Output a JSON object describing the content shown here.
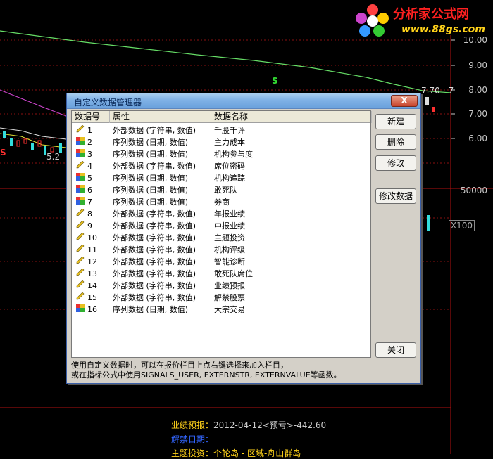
{
  "background": {
    "price_axis": [
      "10.00",
      "9.00",
      "8.00",
      "7.00",
      "6.00"
    ],
    "volume_label": "50000",
    "x_label": "X100",
    "markers": [
      "S",
      "S",
      "S"
    ],
    "low_label": "5.2",
    "high_label": "7.70 - 7"
  },
  "logo": {
    "text": "分析家公式网",
    "url": "www.88gs.com"
  },
  "footer": {
    "line1_label": "业绩预报：",
    "line1_value": "2012-04-12<预亏>-442.60",
    "line2": "解禁日期：",
    "line3": "主题投资：个轮岛 - 区域-舟山群岛"
  },
  "dialog": {
    "title": "自定义数据管理器",
    "close_label": "X",
    "columns": [
      "数据号",
      "属性",
      "数据名称"
    ],
    "rows": [
      {
        "num": "1",
        "attr": "外部数据 (字符串, 数值)",
        "name": "千股千评",
        "icon": "pencil-icon"
      },
      {
        "num": "2",
        "attr": "序列数据 (日期, 数值)",
        "name": "主力成本",
        "icon": "multicolor-data-icon"
      },
      {
        "num": "3",
        "attr": "序列数据 (日期, 数值)",
        "name": "机构参与度",
        "icon": "multicolor-data-icon"
      },
      {
        "num": "4",
        "attr": "外部数据 (字符串, 数值)",
        "name": "席位密码",
        "icon": "pencil-icon"
      },
      {
        "num": "5",
        "attr": "序列数据 (日期, 数值)",
        "name": "机构追踪",
        "icon": "multicolor-data-icon"
      },
      {
        "num": "6",
        "attr": "序列数据 (日期, 数值)",
        "name": "敢死队",
        "icon": "multicolor-data-icon"
      },
      {
        "num": "7",
        "attr": "序列数据 (日期, 数值)",
        "name": "券商",
        "icon": "multicolor-data-icon"
      },
      {
        "num": "8",
        "attr": "外部数据 (字符串, 数值)",
        "name": "年报业绩",
        "icon": "pencil-icon"
      },
      {
        "num": "9",
        "attr": "外部数据 (字符串, 数值)",
        "name": "中报业绩",
        "icon": "pencil-icon"
      },
      {
        "num": "10",
        "attr": "外部数据 (字符串, 数值)",
        "name": "主题投资",
        "icon": "pencil-icon"
      },
      {
        "num": "11",
        "attr": "外部数据 (字符串, 数值)",
        "name": "机构评级",
        "icon": "pencil-icon"
      },
      {
        "num": "12",
        "attr": "外部数据 (字符串, 数值)",
        "name": "智能诊断",
        "icon": "pencil-icon"
      },
      {
        "num": "13",
        "attr": "外部数据 (字符串, 数值)",
        "name": "敢死队席位",
        "icon": "pencil-icon"
      },
      {
        "num": "14",
        "attr": "外部数据 (字符串, 数值)",
        "name": "业绩预报",
        "icon": "pencil-icon"
      },
      {
        "num": "15",
        "attr": "外部数据 (字符串, 数值)",
        "name": "解禁股票",
        "icon": "pencil-icon"
      },
      {
        "num": "16",
        "attr": "序列数据 (日期, 数值)",
        "name": "大宗交易",
        "icon": "multicolor-data-icon"
      }
    ],
    "buttons": {
      "new": "新建",
      "delete": "删除",
      "modify": "修改",
      "modify_data": "修改数据",
      "close": "关闭"
    },
    "status_line1": "使用自定义数据时，可以在报价栏目上点右键选择来加入栏目，",
    "status_line2": "或在指标公式中使用SIGNALS_USER, EXTERNSTR, EXTERNVALUE等函数。"
  },
  "colors": {
    "title_gradient_top": "#a9cdf0",
    "close_red": "#c8442c",
    "chart_green": "#66dd66",
    "chart_magenta": "#cc44cc",
    "chart_red": "#ff2020",
    "chart_cyan": "#33dddd"
  }
}
